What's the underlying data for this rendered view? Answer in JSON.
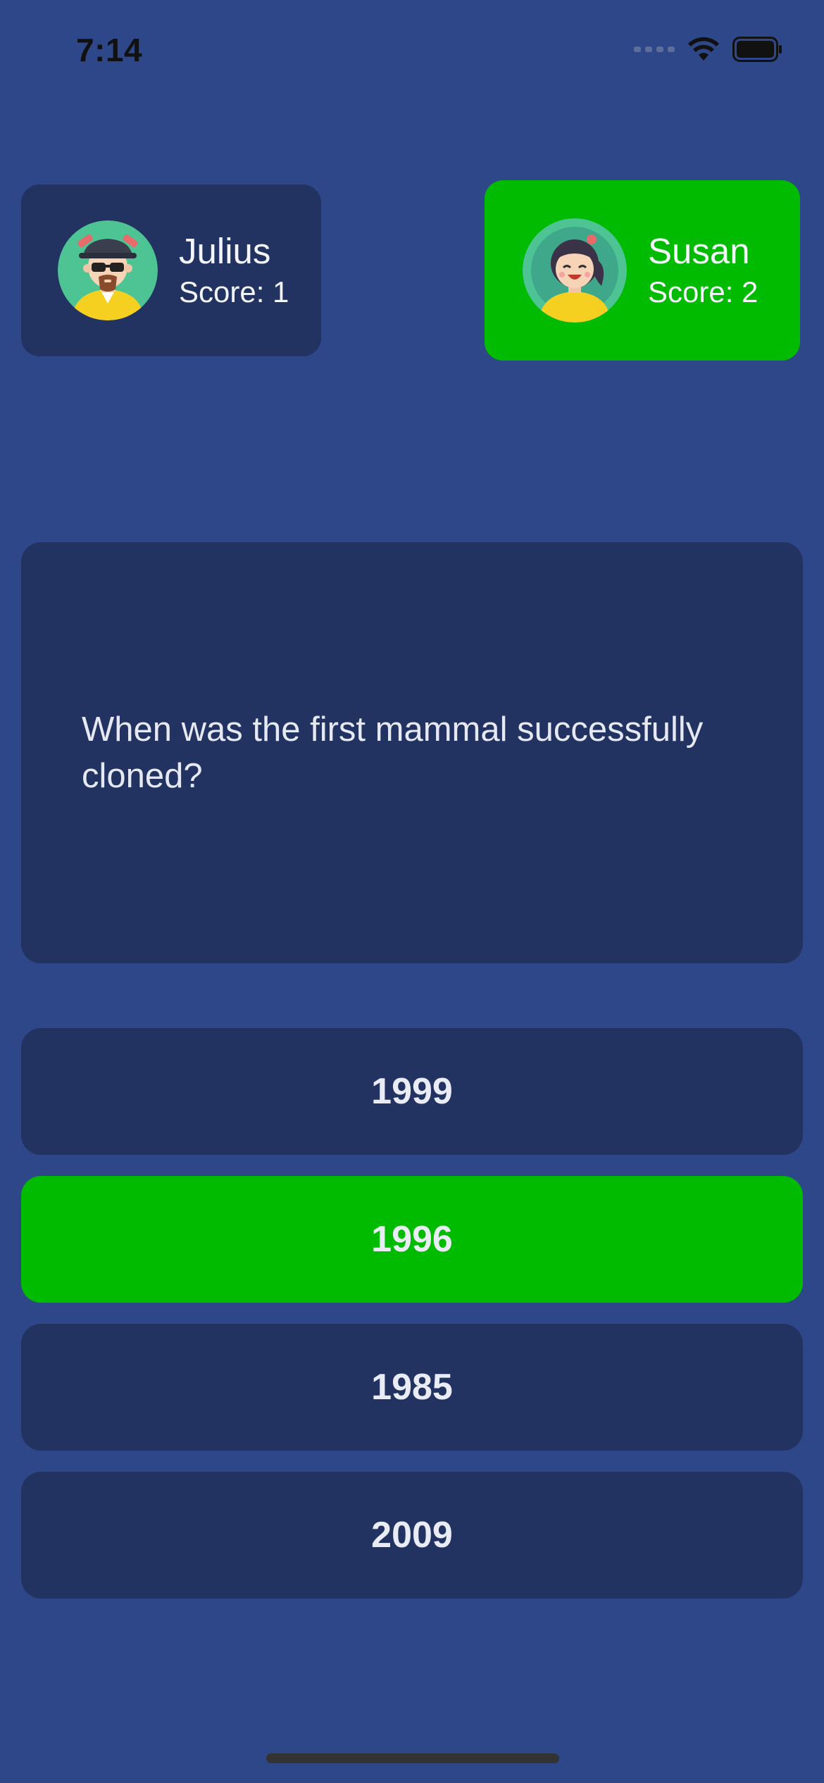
{
  "status_bar": {
    "time": "7:14"
  },
  "players": [
    {
      "name": "Julius",
      "score": "Score: 1",
      "avatar_icon": "bearded-man-avatar-icon",
      "active": false
    },
    {
      "name": "Susan",
      "score": "Score: 2",
      "avatar_icon": "smiling-girl-avatar-icon",
      "active": true
    }
  ],
  "question": {
    "text": "When was the first mammal successfully cloned?"
  },
  "answers": [
    {
      "label": "1999",
      "state": "default"
    },
    {
      "label": "1996",
      "state": "correct"
    },
    {
      "label": "1985",
      "state": "default"
    },
    {
      "label": "2009",
      "state": "default"
    }
  ],
  "colors": {
    "background": "#2e4788",
    "card": "#223362",
    "highlight": "#00bb00"
  }
}
